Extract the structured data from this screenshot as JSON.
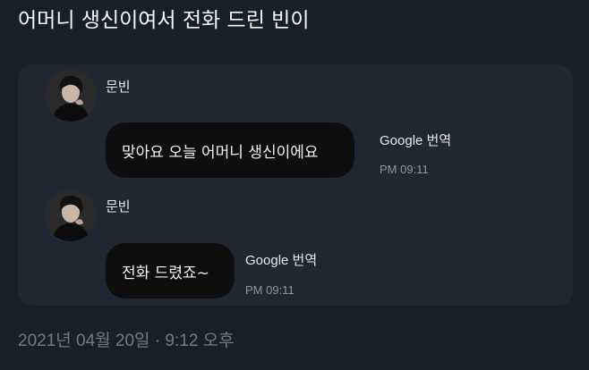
{
  "tweet": {
    "text": "어머니 생신이여서 전화 드린 빈이",
    "timestamp": "2021년 04월 20일 · 9:12 오후"
  },
  "chat": {
    "messages": [
      {
        "sender": "문빈",
        "text": "맞아요 오늘 어머니 생신이에요",
        "translate_label": "Google 번역",
        "time": "PM 09:11"
      },
      {
        "sender": "문빈",
        "text": "전화 드렸죠~",
        "translate_label": "Google 번역",
        "time": "PM 09:11"
      }
    ]
  },
  "colors": {
    "background": "#15202b",
    "card": "#1e2732",
    "bubble": "#0e0e0e",
    "muted_text": "#8b98a5"
  }
}
